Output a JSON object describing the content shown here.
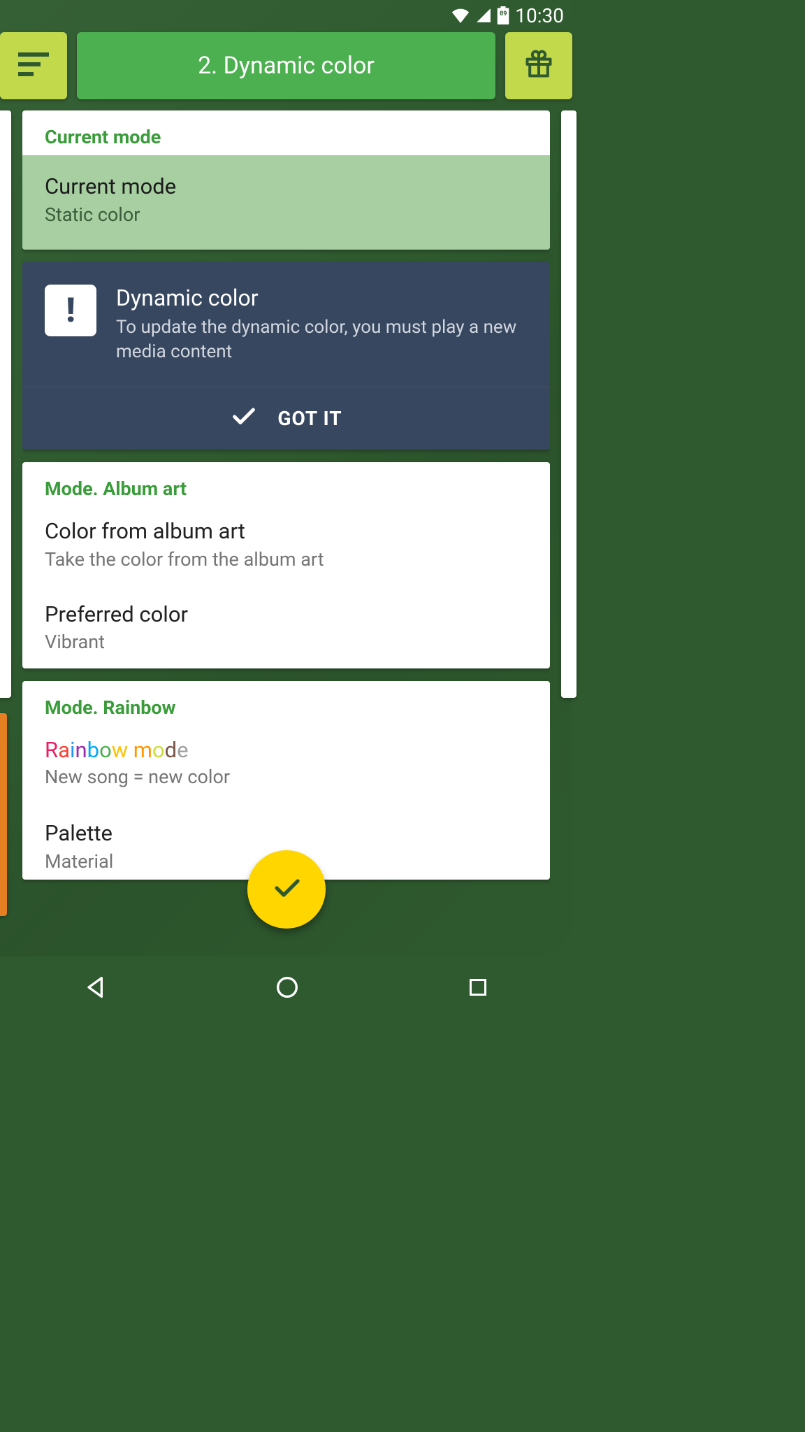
{
  "status_bar": {
    "battery_level": "89",
    "time": "10:30"
  },
  "top_bar": {
    "title": "2. Dynamic color"
  },
  "cards": {
    "current_mode": {
      "header": "Current mode",
      "row": {
        "title": "Current mode",
        "subtitle": "Static color"
      }
    },
    "info": {
      "title": "Dynamic color",
      "body": "To update the dynamic color, you must play a new media content",
      "action_label": "GOT IT"
    },
    "album_art": {
      "header": "Mode. Album art",
      "row1": {
        "title": "Color from album art",
        "subtitle": "Take the color from the album art"
      },
      "row2": {
        "title": "Preferred color",
        "subtitle": "Vibrant"
      }
    },
    "rainbow": {
      "header": "Mode. Rainbow",
      "row1": {
        "title": "Rainbow mode",
        "subtitle": "New song = new color"
      },
      "row2": {
        "title": "Palette",
        "subtitle": "Material"
      }
    }
  },
  "colors": {
    "accent_lime": "#c2d94c",
    "accent_green": "#4CAF50",
    "card_bg": "#ffffff",
    "info_bg": "#37475f",
    "fab": "#ffd600",
    "bg": "#2f5a2f"
  }
}
